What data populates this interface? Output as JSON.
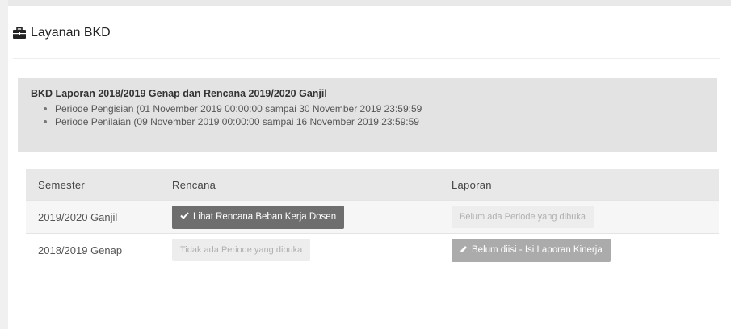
{
  "panel": {
    "title": "Layanan BKD",
    "title_icon": "briefcase-icon"
  },
  "info": {
    "title": "BKD Laporan 2018/2019 Genap dan Rencana 2019/2020 Ganjil",
    "items": [
      "Periode Pengisian (01 November 2019 00:00:00 sampai 30 November 2019 23:59:59",
      "Periode Penilaian (09 November 2019 00:00:00 sampai 16 November 2019 23:59:59"
    ]
  },
  "table": {
    "headers": [
      "Semester",
      "Rencana",
      "Laporan"
    ],
    "rows": [
      {
        "semester": "2019/2020 Ganjil",
        "rencana": "Lihat Rencana Beban Kerja Dosen",
        "rencana_icon": "check-icon",
        "laporan": "Belum ada Periode yang dibuka"
      },
      {
        "semester": "2018/2019 Genap",
        "rencana": "Tidak ada Periode yang dibuka",
        "laporan": "Belum diisi - Isi Laporan Kinerja",
        "laporan_icon": "pencil-icon"
      }
    ]
  },
  "colors": {
    "info_bg": "#e3e3e3",
    "header_bg": "#e8e8e8",
    "btn_dark": "#6e6e6e",
    "btn_mid": "#ababab",
    "pill_light": "#ededed"
  }
}
